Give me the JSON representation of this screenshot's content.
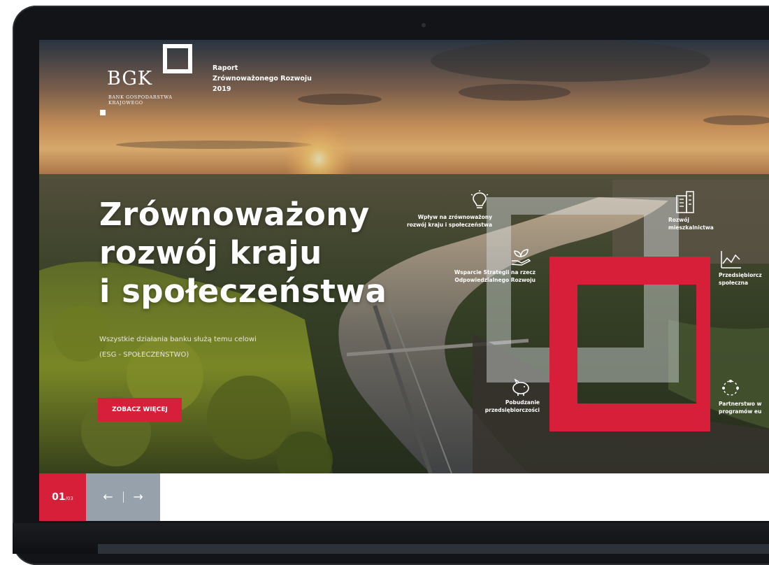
{
  "header": {
    "logo_text": "BGK",
    "logo_sub_1": "BANK GOSPODARSTWA",
    "logo_sub_2": "KRAJOWEGO",
    "report_line_1": "Raport",
    "report_line_2": "Zrównoważonego Rozwoju",
    "report_line_3": "2019"
  },
  "hero": {
    "title_line_1": "Zrównoważony",
    "title_line_2": "rozwój kraju",
    "title_line_3": "i społeczeństwa",
    "subtitle_1": "Wszystkie działania banku służą temu celowi",
    "subtitle_2": "(ESG - SPOŁECZEŃSTWO)",
    "cta_label": "ZOBACZ WIĘCEJ"
  },
  "themes": [
    {
      "icon": "lightbulb-icon",
      "line_1": "Wpływ na zrównoważony",
      "line_2": "rozwój kraju i społeczeństwa"
    },
    {
      "icon": "plant-hand-icon",
      "line_1": "Wsparcie Strategii na rzecz",
      "line_2": "Odpowiedzialnego Rozwoju"
    },
    {
      "icon": "piggy-bank-icon",
      "line_1": "Pobudzanie",
      "line_2": "przedsiębiorczości"
    },
    {
      "icon": "building-icon",
      "line_1": "Rozwój",
      "line_2": "mieszkalnictwa"
    },
    {
      "icon": "chart-icon",
      "line_1": "Przedsiębiorcz",
      "line_2": "społeczna"
    },
    {
      "icon": "network-icon",
      "line_1": "Partnerstwo w",
      "line_2": "programów eu"
    }
  ],
  "slider": {
    "current": "01",
    "total": "/03",
    "prev_label": "←",
    "next_label": "→"
  },
  "colors": {
    "accent": "#d81f3a",
    "nav_gray": "#97a1ab"
  }
}
